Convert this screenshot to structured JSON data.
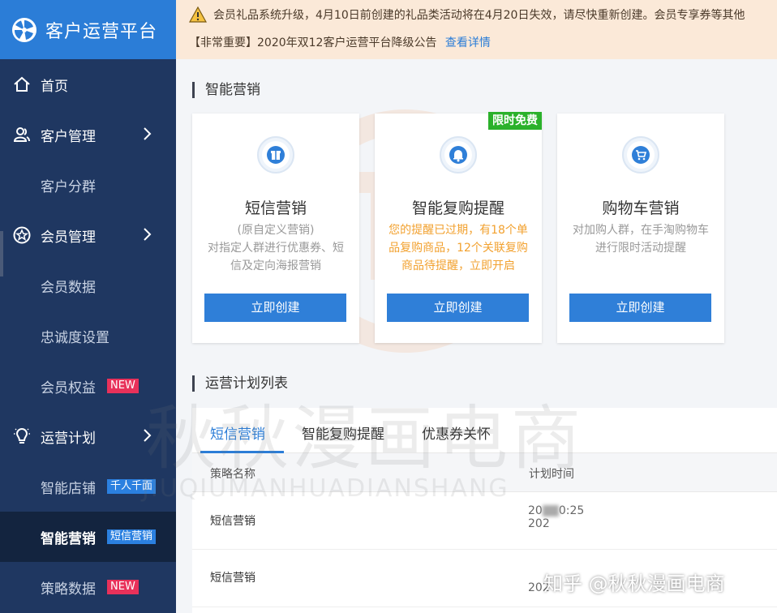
{
  "app": {
    "title": "客户运营平台"
  },
  "sidebar": {
    "items": [
      {
        "label": "首页",
        "level": "top",
        "icon": "home-icon"
      },
      {
        "label": "客户管理",
        "level": "top",
        "icon": "users-icon",
        "chevron": true
      },
      {
        "label": "客户分群",
        "level": "sub"
      },
      {
        "label": "会员管理",
        "level": "top",
        "icon": "star-icon",
        "chevron": true
      },
      {
        "label": "会员数据",
        "level": "sub"
      },
      {
        "label": "忠诚度设置",
        "level": "sub"
      },
      {
        "label": "会员权益",
        "level": "sub",
        "badge": "NEW",
        "badge_color": "#e8315a"
      },
      {
        "label": "运营计划",
        "level": "top",
        "icon": "lightbulb-icon",
        "chevron": true
      },
      {
        "label": "智能店铺",
        "level": "sub",
        "badge": "千人千面",
        "badge_color": "#2b80e0"
      },
      {
        "label": "智能营销",
        "level": "sub",
        "badge": "短信营销",
        "badge_color": "#2b80e0",
        "active": true
      },
      {
        "label": "策略数据",
        "level": "sub",
        "badge": "NEW",
        "badge_color": "#e8315a"
      }
    ]
  },
  "notice": {
    "line1": "会员礼品系统升级，4月10日前创建的礼品类活动将在4月20日失效，请尽快重新创建。会员专享券等其他",
    "line2": "【非常重要】2020年双12客户运营平台降级公告",
    "link": "查看详情"
  },
  "marketing": {
    "section_title": "智能营销",
    "cards": [
      {
        "title": "短信营销",
        "desc": "(原自定义营销)\n对指定人群进行优惠券、短信及定向海报营销",
        "button": "立即创建",
        "icon": "gift-icon"
      },
      {
        "title": "智能复购提醒",
        "desc": "您的提醒已过期，有18个单品复购商品，12个关联复购商品待提醒，立即开启",
        "button": "立即创建",
        "icon": "bell-icon",
        "tag": "限时免费"
      },
      {
        "title": "购物车营销",
        "desc": "对加购人群，在手淘购物车进行限时活动提醒",
        "button": "立即创建",
        "icon": "cart-icon"
      }
    ]
  },
  "plans": {
    "section_title": "运营计划列表",
    "tabs": [
      "短信营销",
      "智能复购提醒",
      "优惠券关怀"
    ],
    "active_tab": 0,
    "columns": [
      "策略名称",
      "计划时间"
    ],
    "rows": [
      {
        "name": "短信营销",
        "time1": "20",
        "time1b": "0:25",
        "time2": "202"
      },
      {
        "name": "短信营销",
        "time1": "",
        "time2": "202"
      }
    ]
  },
  "watermark": {
    "big": "秋秋漫画电商",
    "pinyin": "JIUQIUMANHUADIANSHANG",
    "zhihu": "知乎 @秋秋漫画电商"
  },
  "colors": {
    "sidebar": "#1f3761",
    "brand": "#2b7dd7",
    "notice_bg": "#fbe9d8",
    "alert": "#f2a12f",
    "free_tag": "#2bb12b"
  }
}
